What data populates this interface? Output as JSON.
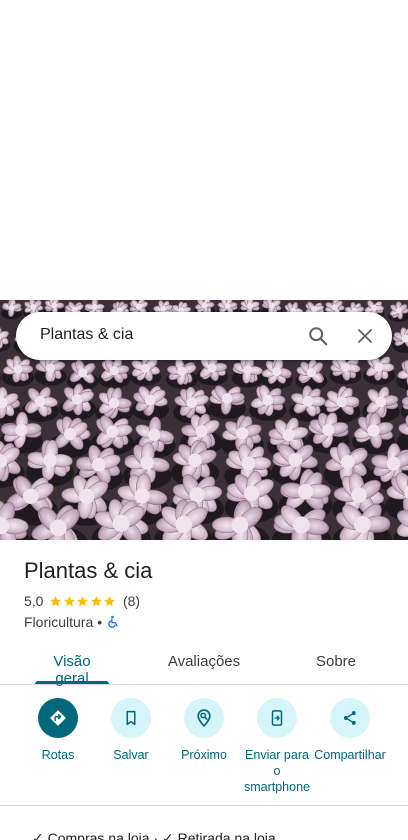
{
  "search": {
    "query": "Plantas & cia"
  },
  "place": {
    "name": "Plantas & cia",
    "rating": "5,0",
    "stars": 5,
    "review_count": "(8)",
    "category": "Floricultura",
    "separator": "•"
  },
  "tabs": [
    {
      "label": "Visão geral",
      "active": true
    },
    {
      "label": "Avaliações",
      "active": false
    },
    {
      "label": "Sobre",
      "active": false
    }
  ],
  "actions": [
    {
      "label": "Rotas",
      "icon": "directions-icon"
    },
    {
      "label": "Salvar",
      "icon": "bookmark-icon"
    },
    {
      "label": "Próximo",
      "icon": "nearby-icon"
    },
    {
      "label": "Enviar para o smartphone",
      "icon": "send-to-phone-icon"
    },
    {
      "label": "Compartilhar",
      "icon": "share-icon"
    }
  ],
  "bottom_peek": "✓ Compras na loja  ·  ✓ Retirada na loja",
  "colors": {
    "accent": "#00687a",
    "accent_light": "#d5f5fb",
    "star": "#fbbc04",
    "accessible": "#1a73e8"
  }
}
